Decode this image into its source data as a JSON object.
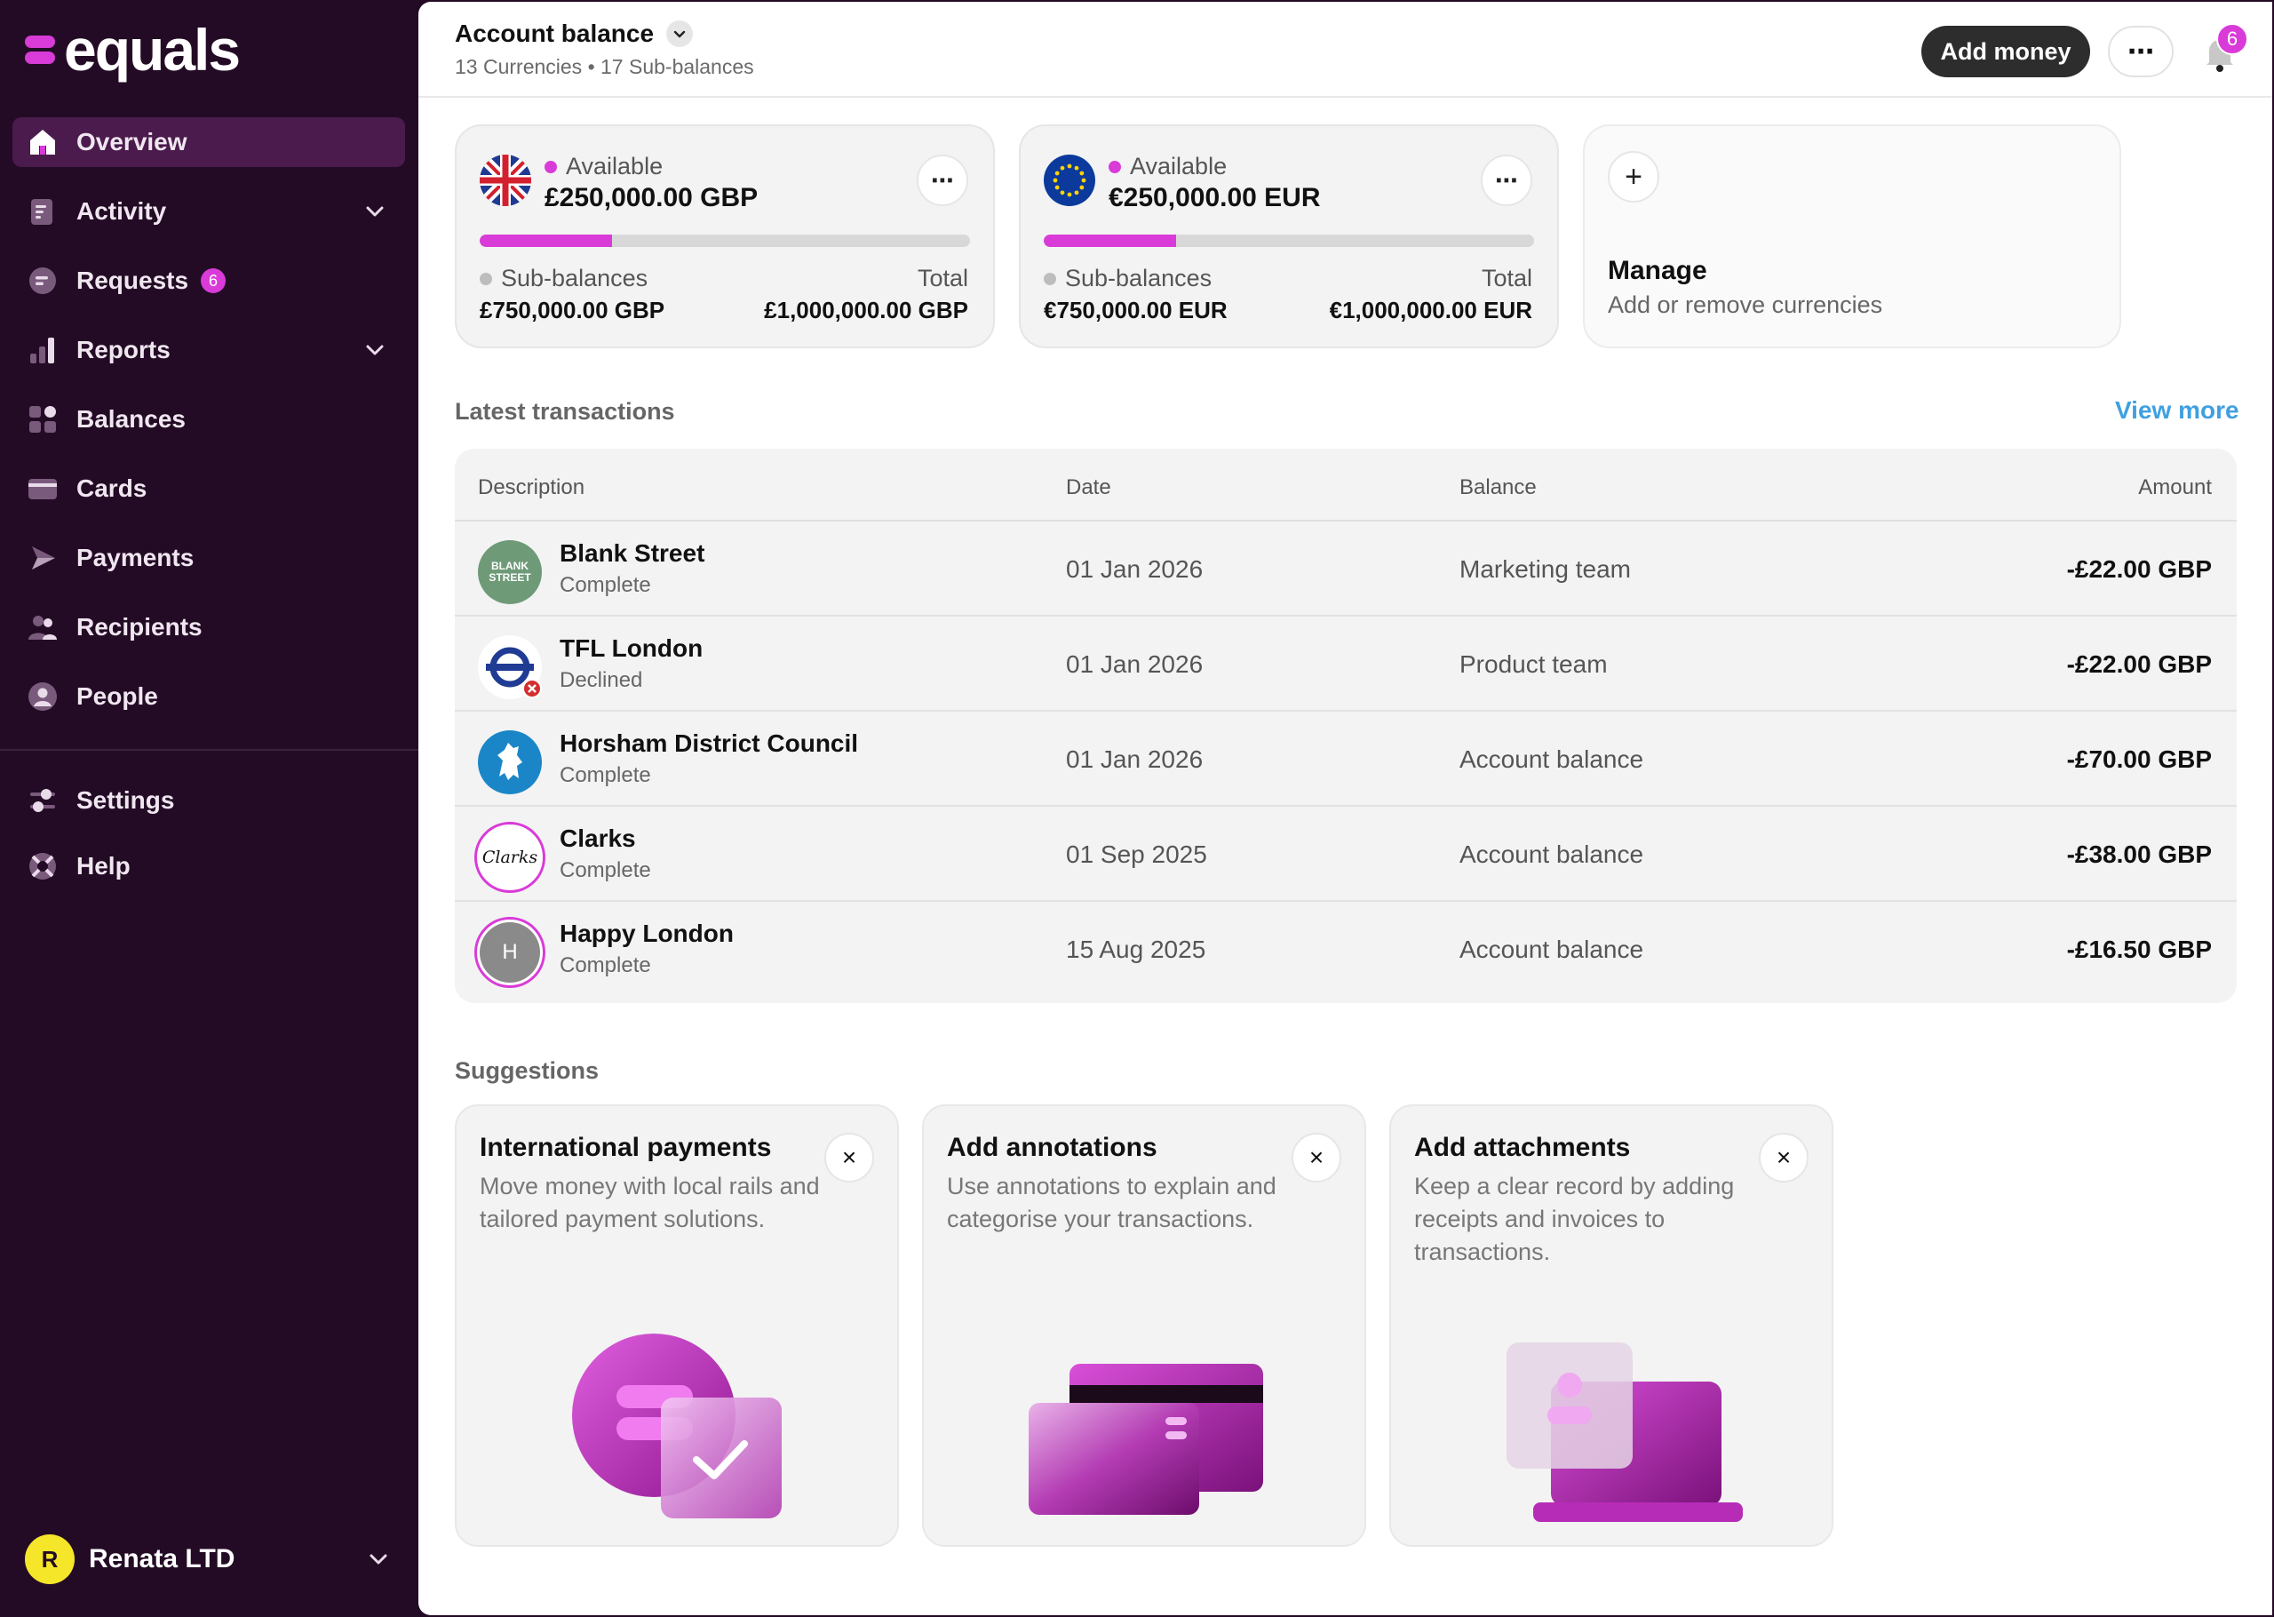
{
  "brand": {
    "logo_text": "equals",
    "accent": "#d93bd8",
    "sidebar_bg": "#230b25"
  },
  "sidebar": {
    "items": [
      {
        "label": "Overview",
        "icon": "home-icon",
        "active": true
      },
      {
        "label": "Activity",
        "icon": "activity-icon",
        "has_chevron": true
      },
      {
        "label": "Requests",
        "icon": "requests-icon",
        "badge": "6"
      },
      {
        "label": "Reports",
        "icon": "reports-icon",
        "has_chevron": true
      },
      {
        "label": "Balances",
        "icon": "balances-icon"
      },
      {
        "label": "Cards",
        "icon": "card-icon"
      },
      {
        "label": "Payments",
        "icon": "payments-icon"
      },
      {
        "label": "Recipients",
        "icon": "recipients-icon"
      },
      {
        "label": "People",
        "icon": "person-icon"
      }
    ],
    "secondary": [
      {
        "label": "Settings",
        "icon": "settings-icon"
      },
      {
        "label": "Help",
        "icon": "help-icon"
      }
    ],
    "org": {
      "initial": "R",
      "name": "Renata LTD"
    }
  },
  "header": {
    "title": "Account balance",
    "subtitle": "13 Currencies • 17 Sub-balances",
    "add_money": "Add money",
    "more": "⋯",
    "notifications": "6"
  },
  "balances": [
    {
      "currency": "GBP",
      "available_label": "Available",
      "available": "£250,000.00 GBP",
      "fill_fraction": 0.27,
      "sub_label": "Sub-balances",
      "sub_amount": "£750,000.00 GBP",
      "total_label": "Total",
      "total_amount": "£1,000,000.00 GBP"
    },
    {
      "currency": "EUR",
      "available_label": "Available",
      "available": "€250,000.00 EUR",
      "fill_fraction": 0.27,
      "sub_label": "Sub-balances",
      "sub_amount": "€750,000.00 EUR",
      "total_label": "Total",
      "total_amount": "€1,000,000.00 EUR"
    }
  ],
  "manage": {
    "plus": "+",
    "title": "Manage",
    "subtitle": "Add or remove currencies"
  },
  "transactions": {
    "title": "Latest transactions",
    "view_more": "View more",
    "columns": {
      "description": "Description",
      "date": "Date",
      "balance": "Balance",
      "amount": "Amount"
    },
    "rows": [
      {
        "name": "Blank Street",
        "status": "Complete",
        "date": "01 Jan 2026",
        "balance": "Marketing team",
        "amount": "-£22.00 GBP",
        "logo_text": "BLANK STREET"
      },
      {
        "name": "TFL London",
        "status": "Declined",
        "date": "01 Jan 2026",
        "balance": "Product team",
        "amount": "-£22.00 GBP"
      },
      {
        "name": "Horsham District Council",
        "status": "Complete",
        "date": "01 Jan 2026",
        "balance": "Account balance",
        "amount": "-£70.00 GBP"
      },
      {
        "name": "Clarks",
        "status": "Complete",
        "date": "01 Sep 2025",
        "balance": "Account balance",
        "amount": "-£38.00 GBP",
        "logo_text": "Clarks"
      },
      {
        "name": "Happy London",
        "status": "Complete",
        "date": "15 Aug 2025",
        "balance": "Account balance",
        "amount": "-£16.50 GBP",
        "logo_text": "H"
      }
    ]
  },
  "suggestions": {
    "title": "Suggestions",
    "cards": [
      {
        "title": "International payments",
        "description": "Move money with local rails and tailored payment solutions."
      },
      {
        "title": "Add annotations",
        "description": "Use annotations to explain and categorise your transactions."
      },
      {
        "title": "Add attachments",
        "description": "Keep a clear record by adding receipts and invoices to transactions."
      }
    ],
    "close": "×"
  }
}
